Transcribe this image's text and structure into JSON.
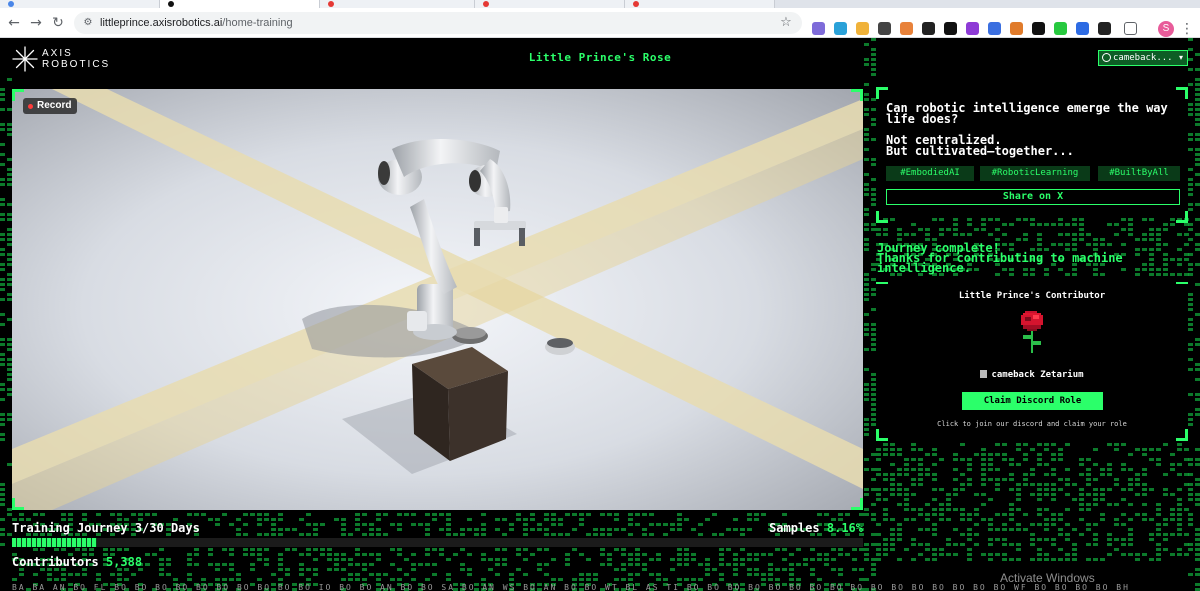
{
  "browser": {
    "url_host": "littleprince.axisrobotics.ai",
    "url_path": "/home-training",
    "profile_initial": "S",
    "icons": [
      "back-arrow-icon",
      "forward-arrow-icon",
      "reload-icon",
      "site-info-icon",
      "bookmark-star-icon",
      "extensions-puzzle-icon",
      "kebab-menu-icon"
    ]
  },
  "header": {
    "logo_text": "AXIS\nROBOTICS",
    "title": "Little Prince's Rose",
    "user_label": "cameback..."
  },
  "viewport": {
    "record_label": "Record"
  },
  "stats": {
    "journey_label": "Training Journey 3/30 Days",
    "samples_label": "Samples",
    "samples_value": "8.16%",
    "progress_fraction": 0.1,
    "contributors_label": "Contributors",
    "contributors_value": "5,388",
    "ticker_text": "BA BA AN BO FL BO BO BO BO BO BO BO BO BO BO IO BO BO AN BO BO SA BO AN WS BO AN BO BO WT BL AS TI BO BO BO BO BO BO BO BO BO BO BO BO BO BO BO BO WF BO BO BO BO BH"
  },
  "panel": {
    "question": "Can robotic intelligence emerge the way life does?",
    "answer_line1": "Not centralized.",
    "answer_line2": "But cultivated—together...",
    "tags": [
      "#EmbodiedAI",
      "#RoboticLearning",
      "#BuiltByAll"
    ],
    "share_label": "Share on X",
    "complete_line1": "Journey complete!",
    "complete_line2": "Thanks for contributing to machine intelligence.",
    "card_title": "Little Prince's Contributor",
    "username": "cameback Zetarium",
    "claim_label": "Claim Discord Role",
    "claim_hint": "Click to join our discord and claim your role"
  },
  "os": {
    "watermark": "Activate Windows"
  },
  "colors": {
    "accent": "#2bff6a",
    "accent_dark": "#0d5d25",
    "background": "#000000"
  }
}
